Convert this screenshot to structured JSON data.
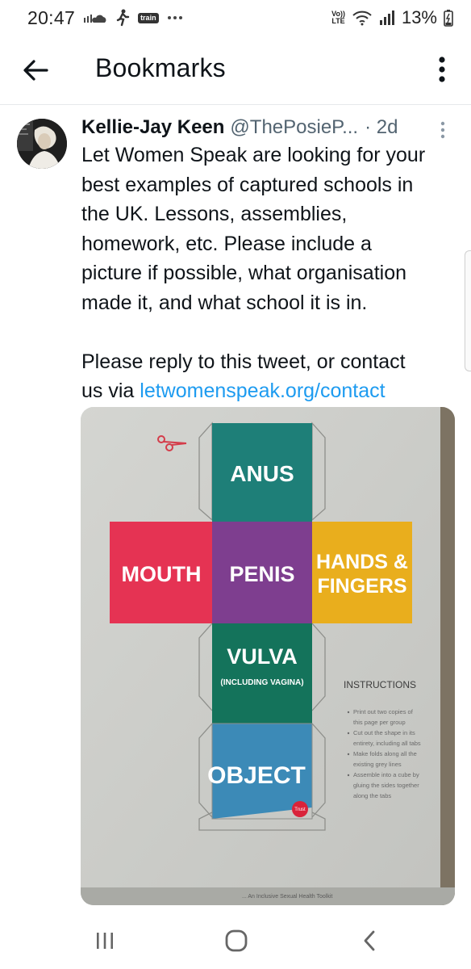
{
  "status_bar": {
    "time": "20:47",
    "train_label": "train",
    "volte_label_line1": "Vo))",
    "volte_label_line2": "LTE",
    "battery": "13%"
  },
  "app_bar": {
    "title": "Bookmarks",
    "back_icon": "arrow-left-icon",
    "menu_icon": "more-vertical-icon"
  },
  "tweet": {
    "author_name": "Kellie-Jay Keen",
    "author_handle": "@ThePosieP...",
    "time": "· 2d",
    "text_lines": [
      "Let Women Speak are looking for your",
      "best examples of captured schools in",
      "the UK. Lessons, assemblies,",
      "homework, etc. Please include a",
      "picture if possible, what organisation",
      "made it, and what school it is in."
    ],
    "text2_line1": "Please reply to this tweet, or contact",
    "text2_prefix": "us via ",
    "link": "letwomenspeak.org/contact",
    "link_color": "#1d9bf0"
  },
  "media": {
    "faces": {
      "top": "ANUS",
      "left": "MOUTH",
      "center": "PENIS",
      "right_line1": "HANDS &",
      "right_line2": "FINGERS",
      "lower_line1": "VULVA",
      "lower_line2": "(INCLUDING VAGINA)",
      "bottom": "OBJECT"
    },
    "instructions_title": "INSTRUCTIONS",
    "instructions": [
      "Print out two copies of",
      "this page per group",
      "Cut out the shape in its",
      "entirety, including all tabs",
      "Make folds along all the",
      "existing grey lines",
      "Assemble into a cube by",
      "gluing the sides together",
      "along the tabs"
    ],
    "logo_text": "Trust",
    "footer_text": "... An Inclusive Sexual Health Toolkit",
    "colors": {
      "teal": "#1e7f78",
      "red": "#e53353",
      "purple": "#7e3e8f",
      "yellow": "#e9ae1d",
      "green": "#14735b",
      "blue": "#3c8ab7"
    }
  },
  "nav_bar": {
    "recents_icon": "recent-apps-icon",
    "home_icon": "home-icon",
    "back_icon": "chevron-left-icon"
  }
}
